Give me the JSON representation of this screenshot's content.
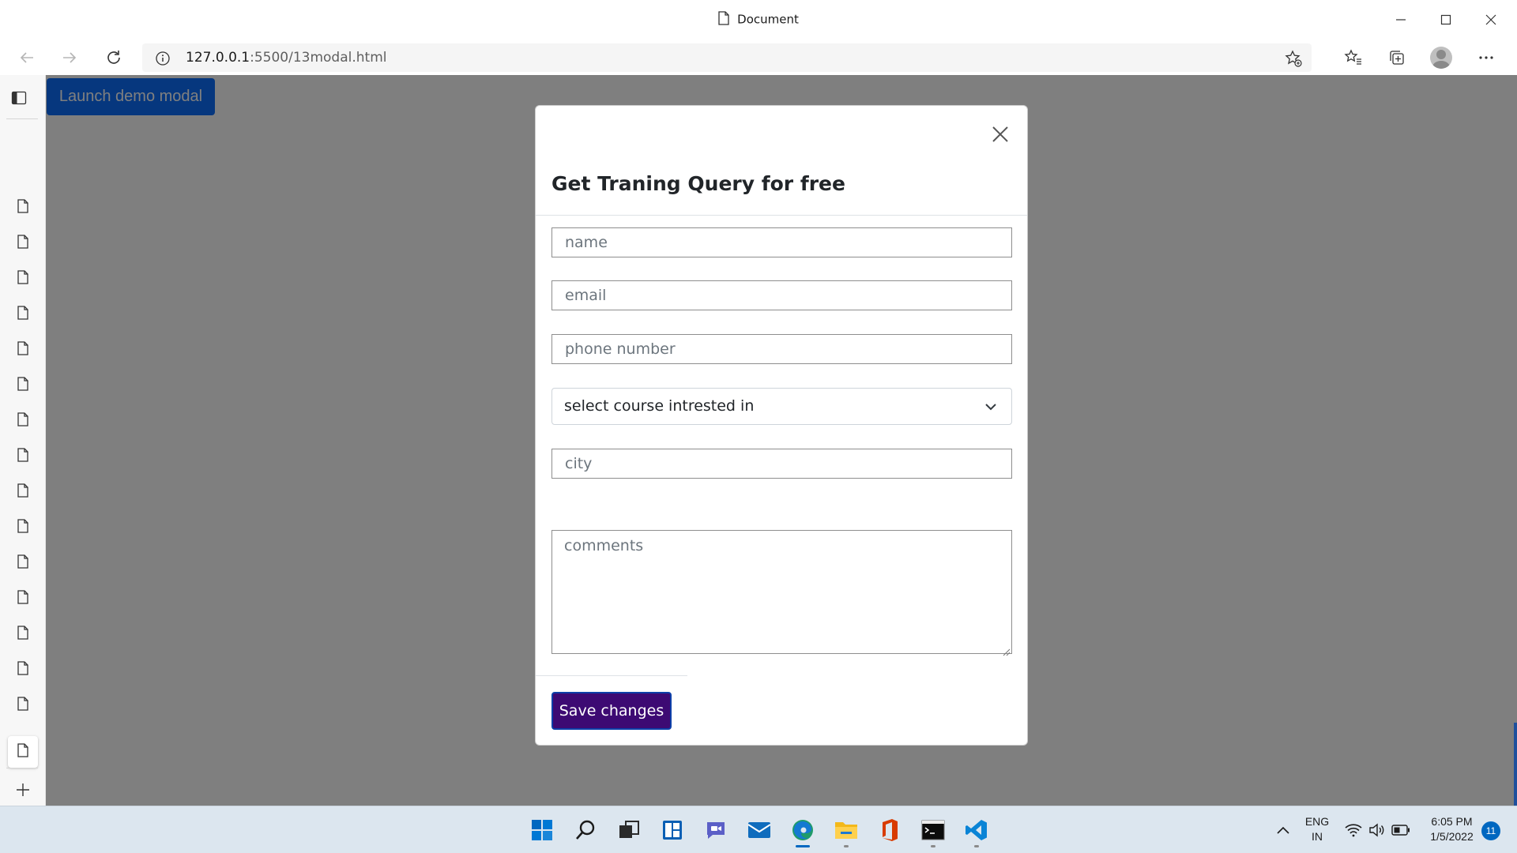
{
  "window": {
    "title": "Document"
  },
  "address_bar": {
    "url_host": "127.0.0.1",
    "url_path": ":5500/13modal.html"
  },
  "page": {
    "launch_button_label": "Launch demo modal"
  },
  "modal": {
    "title": "Get Traning Query for free",
    "fields": {
      "name_placeholder": "name",
      "email_placeholder": "email",
      "phone_placeholder": "phone number",
      "course_select_value": "select course intrested in",
      "city_placeholder": "city",
      "comments_placeholder": "comments"
    },
    "save_label": "Save changes"
  },
  "taskbar": {
    "language_line1": "ENG",
    "language_line2": "IN",
    "time": "6:05 PM",
    "date": "1/5/2022",
    "notification_count": "11"
  },
  "colors": {
    "primary": "#0d6efd",
    "save_button": "#3d0a73",
    "backdrop": "rgba(0,0,0,0.5)",
    "taskbar": "#dce6ef"
  }
}
